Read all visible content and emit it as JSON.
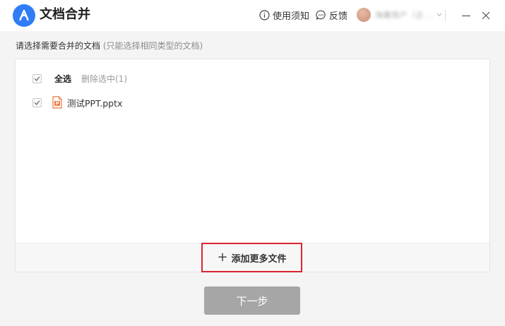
{
  "app": {
    "title": "文档合并"
  },
  "header": {
    "help_label": "使用须知",
    "feedback_label": "反馈",
    "user_name": "海螺用户（企..."
  },
  "instruction": {
    "text": "请选择需要合并的文档",
    "hint": "(只能选择相同类型的文档)"
  },
  "file_list": {
    "select_all_label": "全选",
    "select_all_checked": true,
    "delete_selected_label": "删除选中(1)",
    "files": [
      {
        "name": "测试PPT.pptx",
        "checked": true,
        "icon": "pptx-file-icon"
      }
    ]
  },
  "footer": {
    "add_more_label": "添加更多文件"
  },
  "actions": {
    "next_label": "下一步"
  },
  "colors": {
    "brand": "#2f7cf6",
    "highlight_border": "#d9252f",
    "disabled_button": "#a6a6a6",
    "pptx_icon": "#e8743b"
  }
}
